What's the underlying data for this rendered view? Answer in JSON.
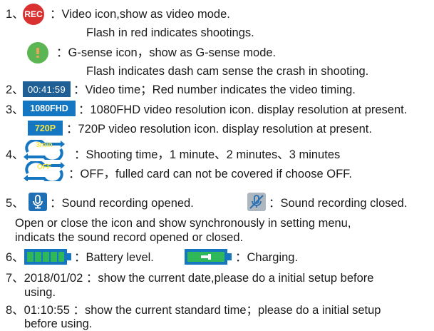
{
  "items": {
    "n1": "1、",
    "rec_icon_text": "REC",
    "l1a": "：Video icon,show as video mode.",
    "l1b": "Flash in red indicates shootings.",
    "l1c": "：G-sense icon，show as G-sense mode.",
    "l1d": "Flash indicates dash cam sense the crash in shooting.",
    "n2": "2、",
    "time_icon_text": "00:41:59",
    "l2": "：Video time；Red number indicates the video timing.",
    "n3": "3、",
    "fhd_icon_text": "1080FHD",
    "l3a": "：1080FHD video resolution icon. display resolution at present.",
    "p720_icon_text": "720P",
    "l3b": "：720P video resolution icon. display resolution at present.",
    "n4": "4、",
    "cycle_icon_text": "3min",
    "l4a": "：Shooting time，1 minute、2 minutes、3 minutes",
    "off_icon_text": "OFF",
    "l4b": "：OFF，fulled card can not be covered if choose OFF.",
    "n5": "5、",
    "l5a": "：Sound recording opened.",
    "l5b": "：Sound recording closed.",
    "l5c": "Open or close the icon and show synchronously in setting menu,",
    "l5d": "indicats the sound record opened or closed.",
    "n6": "6、",
    "l6a": "：Battery level.",
    "l6b": "：Charging.",
    "l7a": "7、2018/01/02 ：show the current date,please do a initial setup before",
    "l7b": "using.",
    "l8a": "8、01:10:55 ：show the current standard time；please do a initial setup",
    "l8b": "before using."
  },
  "colors": {
    "rec_red": "#d93030",
    "gsense_green": "#5ab552",
    "icon_blue": "#1577c1",
    "battery_green": "#2fb85a"
  }
}
